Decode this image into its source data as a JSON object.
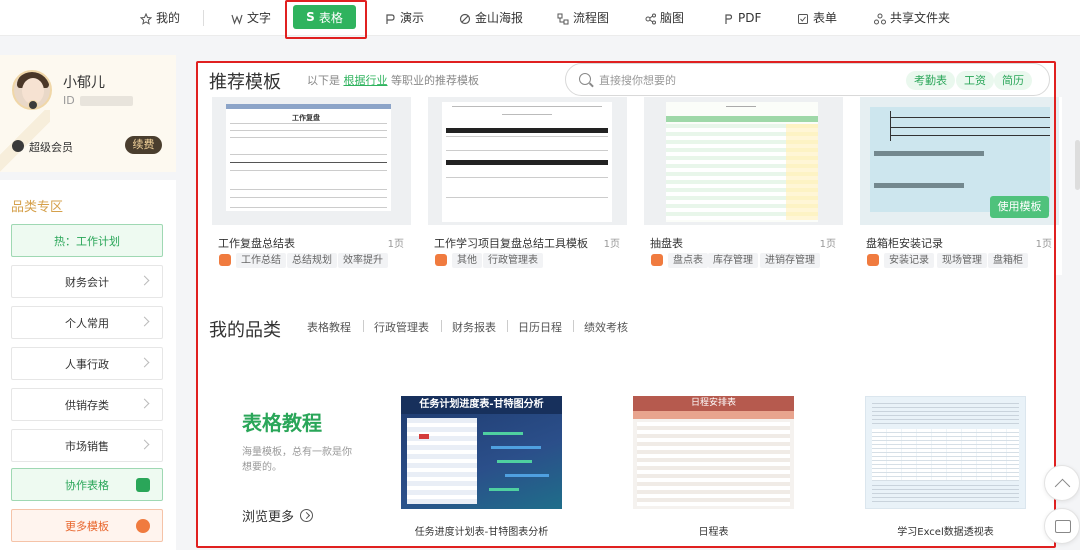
{
  "topnav": {
    "items": [
      {
        "label": "我的",
        "icon": "star-icon"
      },
      {
        "label": "文字",
        "icon": "w-icon"
      },
      {
        "label": "表格",
        "icon": "s-icon",
        "active": true
      },
      {
        "label": "演示",
        "icon": "p-icon"
      },
      {
        "label": "金山海报",
        "icon": "poster-icon"
      },
      {
        "label": "流程图",
        "icon": "flowchart-icon"
      },
      {
        "label": "脑图",
        "icon": "mindmap-icon"
      },
      {
        "label": "PDF",
        "icon": "pdf-icon"
      },
      {
        "label": "表单",
        "icon": "form-icon"
      },
      {
        "label": "共享文件夹",
        "icon": "shared-folder-icon"
      }
    ]
  },
  "profile": {
    "username": "小郁儿",
    "id_label": "ID",
    "vip_label": "超级会员",
    "renew_label": "续费"
  },
  "sidebar": {
    "title": "品类专区",
    "items": [
      {
        "label": "热：工作计划"
      },
      {
        "label": "财务会计"
      },
      {
        "label": "个人常用"
      },
      {
        "label": "人事行政"
      },
      {
        "label": "供销存类"
      },
      {
        "label": "市场销售"
      },
      {
        "label": "协作表格"
      },
      {
        "label": "更多模板"
      }
    ]
  },
  "recommend": {
    "title": "推荐模板",
    "subtitle_prefix": "以下是",
    "subtitle_link": "根据行业",
    "subtitle_suffix": "等职业的推荐模板",
    "search_placeholder": "直接搜你想要的",
    "search_tags": [
      "考勤表",
      "工资",
      "简历"
    ],
    "use_button": "使用模板",
    "cards": [
      {
        "name": "工作复盘总结表",
        "pages": "1页",
        "tags": [
          "工作总结",
          "总结规划",
          "效率提升"
        ],
        "doc_title": "工作复盘"
      },
      {
        "name": "工作学习项目复盘总结工具模板",
        "pages": "1页",
        "tags": [
          "其他",
          "行政管理表"
        ]
      },
      {
        "name": "抽盘表",
        "pages": "1页",
        "tags": [
          "盘点表",
          "库存管理",
          "进销存管理"
        ]
      },
      {
        "name": "盘箱柜安装记录",
        "pages": "1页",
        "tags": [
          "安装记录",
          "现场管理",
          "盘箱柜"
        ]
      }
    ]
  },
  "mypin": {
    "title": "我的品类",
    "nav": [
      "表格教程",
      "行政管理表",
      "财务报表",
      "日历日程",
      "绩效考核"
    ]
  },
  "tutorial": {
    "title": "表格教程",
    "desc": "海量模板，总有一款是你想要的。",
    "more": "浏览更多",
    "cards": [
      {
        "name": "任务进度计划表-甘特图表分析",
        "thumb_title": "任务计划进度表-甘特图分析"
      },
      {
        "name": "日程表",
        "thumb_title": "日程安排表"
      },
      {
        "name": "学习Excel数据透视表",
        "thumb_title": ""
      }
    ]
  },
  "colors": {
    "accent_green": "#2fb35e",
    "highlight_red": "#e02020",
    "vip_gold": "#d5a04b"
  }
}
